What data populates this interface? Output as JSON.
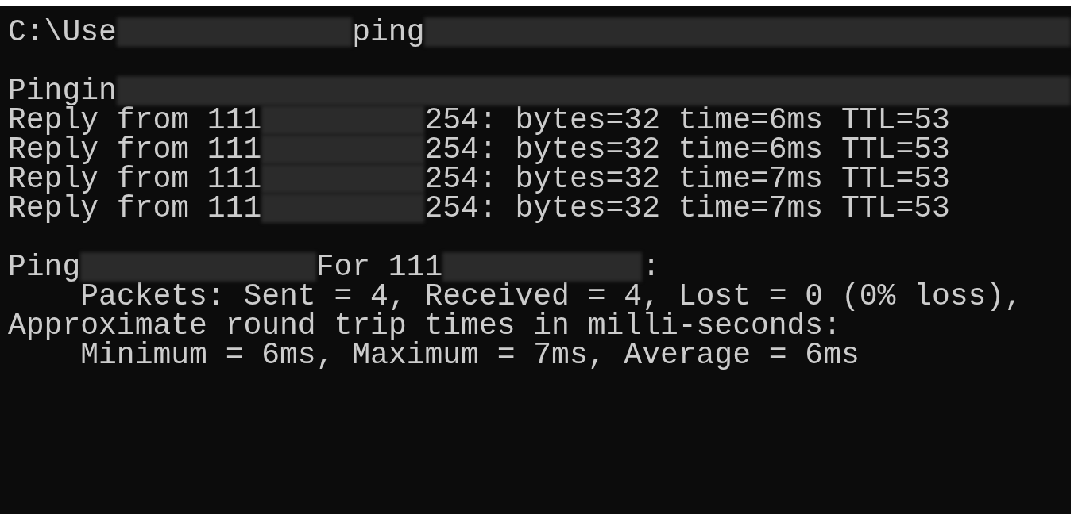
{
  "console": {
    "lines": [
      {
        "kind": "text",
        "segments": [
          {
            "kind": "text",
            "text": "C:\\Use"
          },
          {
            "kind": "redaction"
          },
          {
            "kind": "text",
            "text": "ping"
          },
          {
            "kind": "redaction"
          }
        ]
      },
      {
        "kind": "blank"
      },
      {
        "kind": "text",
        "segments": [
          {
            "kind": "text",
            "text": "Pingin"
          },
          {
            "kind": "redaction"
          }
        ]
      },
      {
        "kind": "text",
        "segments": [
          {
            "kind": "text",
            "text": "Reply from 111"
          },
          {
            "kind": "redaction"
          },
          {
            "kind": "text",
            "text": "254: bytes=32 time=6ms TTL=53"
          }
        ]
      },
      {
        "kind": "text",
        "segments": [
          {
            "kind": "text",
            "text": "Reply from 111"
          },
          {
            "kind": "redaction"
          },
          {
            "kind": "text",
            "text": "254: bytes=32 time=6ms TTL=53"
          }
        ]
      },
      {
        "kind": "text",
        "segments": [
          {
            "kind": "text",
            "text": "Reply from 111"
          },
          {
            "kind": "redaction"
          },
          {
            "kind": "text",
            "text": "254: bytes=32 time=7ms TTL=53"
          }
        ]
      },
      {
        "kind": "text",
        "segments": [
          {
            "kind": "text",
            "text": "Reply from 111"
          },
          {
            "kind": "redaction"
          },
          {
            "kind": "text",
            "text": "254: bytes=32 time=7ms TTL=53"
          }
        ]
      },
      {
        "kind": "blank"
      },
      {
        "kind": "text",
        "segments": [
          {
            "kind": "text",
            "text": "Ping"
          },
          {
            "kind": "redaction"
          },
          {
            "kind": "text",
            "text": "For 111"
          },
          {
            "kind": "redaction"
          },
          {
            "kind": "text",
            "text": ":"
          }
        ]
      },
      {
        "kind": "text",
        "segments": [
          {
            "kind": "text",
            "text": "    Packets: Sent = 4, Received = 4, Lost = 0 (0% loss),"
          }
        ]
      },
      {
        "kind": "text",
        "segments": [
          {
            "kind": "text",
            "text": "Approximate round trip times in milli-seconds:"
          }
        ]
      },
      {
        "kind": "text",
        "segments": [
          {
            "kind": "text",
            "text": "    Minimum = 6ms, Maximum = 7ms, Average = 6ms"
          }
        ]
      }
    ]
  }
}
